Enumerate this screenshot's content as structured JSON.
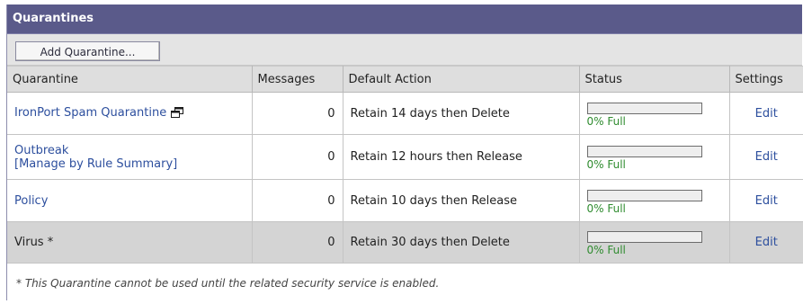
{
  "panel": {
    "title": "Quarantines",
    "add_button_label": "Add Quarantine..."
  },
  "columns": {
    "quarantine": "Quarantine",
    "messages": "Messages",
    "default_action": "Default Action",
    "status": "Status",
    "settings": "Settings"
  },
  "rows": [
    {
      "name": "IronPort Spam Quarantine",
      "sub_link": "",
      "messages": "0",
      "default_action": "Retain 14 days then Delete",
      "status_fraction": 0,
      "status_text": "0% Full",
      "settings": "Edit",
      "icon": "popup-window-icon"
    },
    {
      "name": "Outbreak",
      "sub_link": "[Manage by Rule Summary]",
      "messages": "0",
      "default_action": "Retain 12 hours then Release",
      "status_fraction": 0,
      "status_text": "0% Full",
      "settings": "Edit"
    },
    {
      "name": "Policy",
      "sub_link": "",
      "messages": "0",
      "default_action": "Retain 10 days then Release",
      "status_fraction": 0,
      "status_text": "0% Full",
      "settings": "Edit"
    },
    {
      "name": "Virus *",
      "sub_link": "",
      "messages": "0",
      "default_action": "Retain 30 days then Delete",
      "status_fraction": 0,
      "status_text": "0% Full",
      "settings": "Edit"
    }
  ],
  "footnote": "* This Quarantine cannot be used until the related security service is enabled.",
  "colors": {
    "title_bar": "#5a5a8a",
    "link": "#2d4f9e",
    "status_text": "#2e8b2e",
    "disabled_row": "#d4d4d4"
  }
}
